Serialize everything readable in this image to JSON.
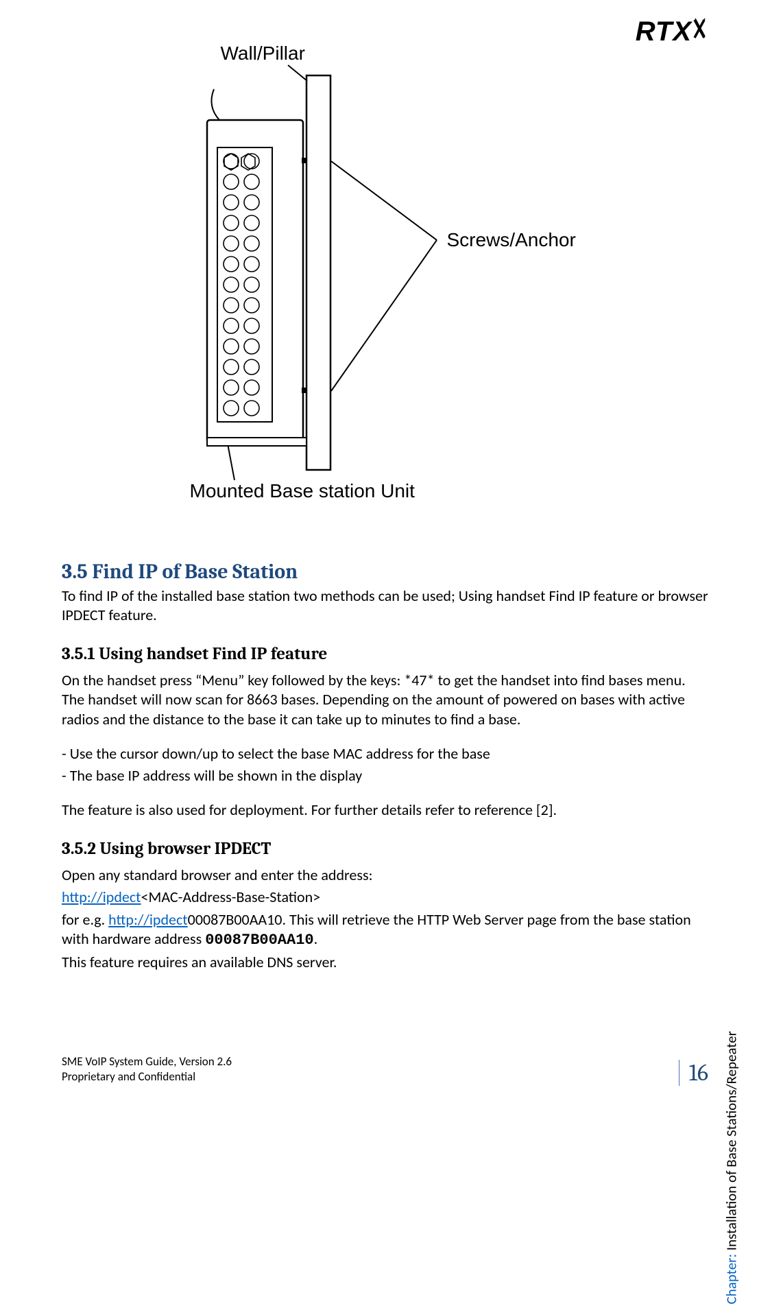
{
  "logo_text": "RTX",
  "figure": {
    "label_top": "Wall/Pillar",
    "label_right": "Screws/Anchor",
    "label_bottom": "Mounted Base station Unit"
  },
  "sec35_title": "3.5 Find IP of Base Station",
  "sec35_intro": "To find IP of the installed base station two methods can be used; Using handset Find IP feature or browser IPDECT feature.",
  "sec351_title": "3.5.1  Using handset Find IP feature",
  "sec351_p1": "On the handset press “Menu” key followed by the keys: *47* to get the handset into find bases menu. The handset will now scan for 8663 bases. Depending on the amount of powered on bases with active radios and the distance to the base it can take up to minutes to find a base.",
  "sec351_b1": "- Use the cursor down/up to select the base MAC address for the base",
  "sec351_b2": "- The base IP address will be shown in the display",
  "sec351_p2": "The feature is also used for deployment. For further details refer to reference [2].",
  "sec352_title": "3.5.2  Using browser IPDECT",
  "sec352_p1": "Open any standard browser and enter the address:",
  "sec352_link1": "http://ipdect",
  "sec352_link1_suffix": "<MAC-Address-Base-Station>",
  "sec352_p2_pre": "for e.g. ",
  "sec352_link2": "http://ipdect",
  "sec352_p2_mid": "00087B00AA10. This will retrieve the HTTP Web Server page from the base station with hardware address ",
  "sec352_mono": "00087B00AA10",
  "sec352_p2_end": ".",
  "sec352_p3": "This feature requires an available DNS server.",
  "footer_l1": "SME VoIP System Guide, Version 2.6",
  "footer_l2": "Proprietary and Confidential",
  "page_number": "16",
  "chapter_label": "Chapter:",
  "chapter_text": " Installation of Base Stations/Repeater"
}
